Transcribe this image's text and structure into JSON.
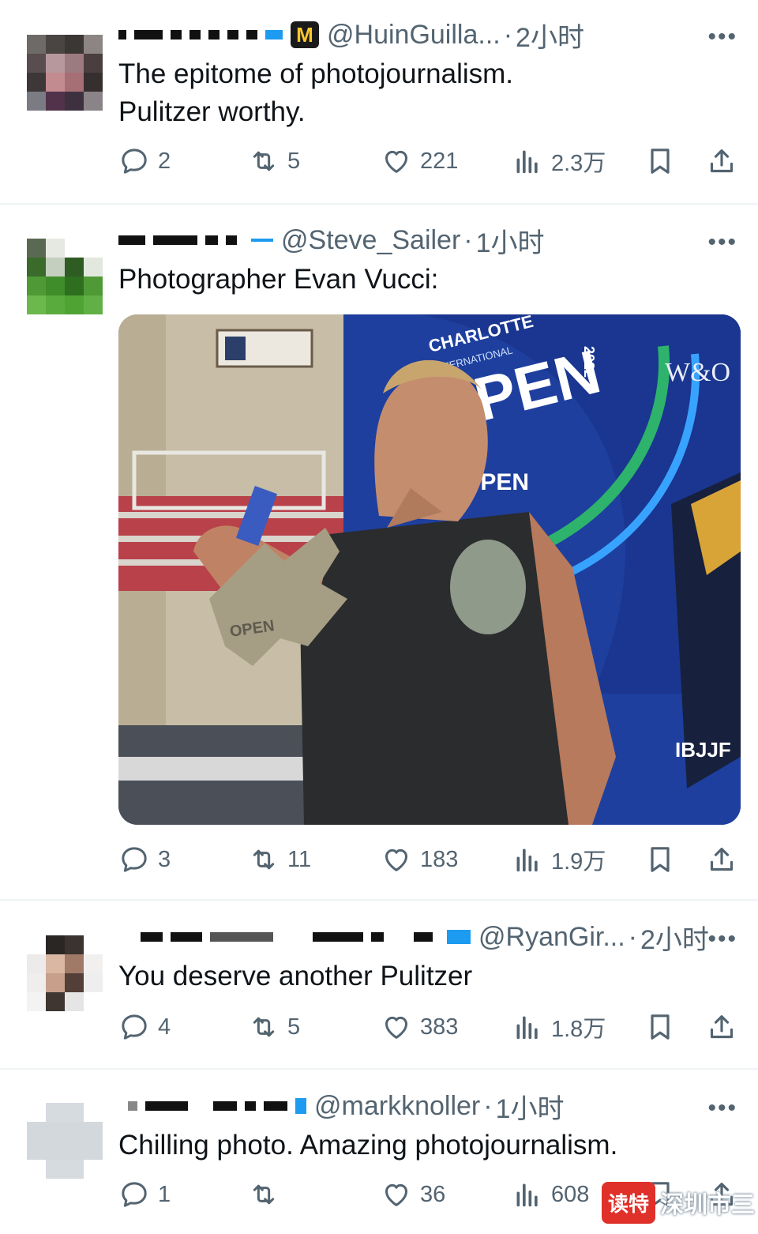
{
  "tweets": [
    {
      "handle": "@HuinGuilla...",
      "time": "2小时",
      "text_lines": [
        "The epitome of photojournalism.",
        "Pulitzer worthy."
      ],
      "replies": "2",
      "retweets": "5",
      "likes": "221",
      "views": "2.3万"
    },
    {
      "handle": "@Steve_Sailer",
      "time": "1小时",
      "text_lines": [
        "Photographer Evan Vucci:"
      ],
      "replies": "3",
      "retweets": "11",
      "likes": "183",
      "views": "1.9万",
      "image": {
        "banner_city": "CHARLOTTE",
        "banner_sub": "INTERNATIONAL",
        "banner_main": "OPEN",
        "banner_year": "2022",
        "banner_small": "OPEN",
        "side_logo": "W&O",
        "medal_text": "OPEN",
        "floor_text": "IBJJF"
      }
    },
    {
      "handle": "@RyanGir...",
      "time": "2小时",
      "text_lines": [
        "You deserve another Pulitzer"
      ],
      "replies": "4",
      "retweets": "5",
      "likes": "383",
      "views": "1.8万"
    },
    {
      "handle": "@markknoller",
      "time": "1小时",
      "text_lines": [
        "Chilling photo. Amazing photojournalism."
      ],
      "replies": "1",
      "retweets": "",
      "likes": "36",
      "views": "608"
    }
  ],
  "dot": "·",
  "more": "•••",
  "badge_letter": "M",
  "watermark": {
    "badge": "读特",
    "text": "深圳市三"
  },
  "colors": {
    "text": "#0f1419",
    "muted": "#536471",
    "verified": "#1d9bf0",
    "divider": "#eff3f4",
    "watermark": "#e0302a"
  },
  "icons": [
    "reply-icon",
    "retweet-icon",
    "like-icon",
    "views-icon",
    "bookmark-icon",
    "share-icon",
    "more-icon",
    "verified-badge-icon"
  ]
}
